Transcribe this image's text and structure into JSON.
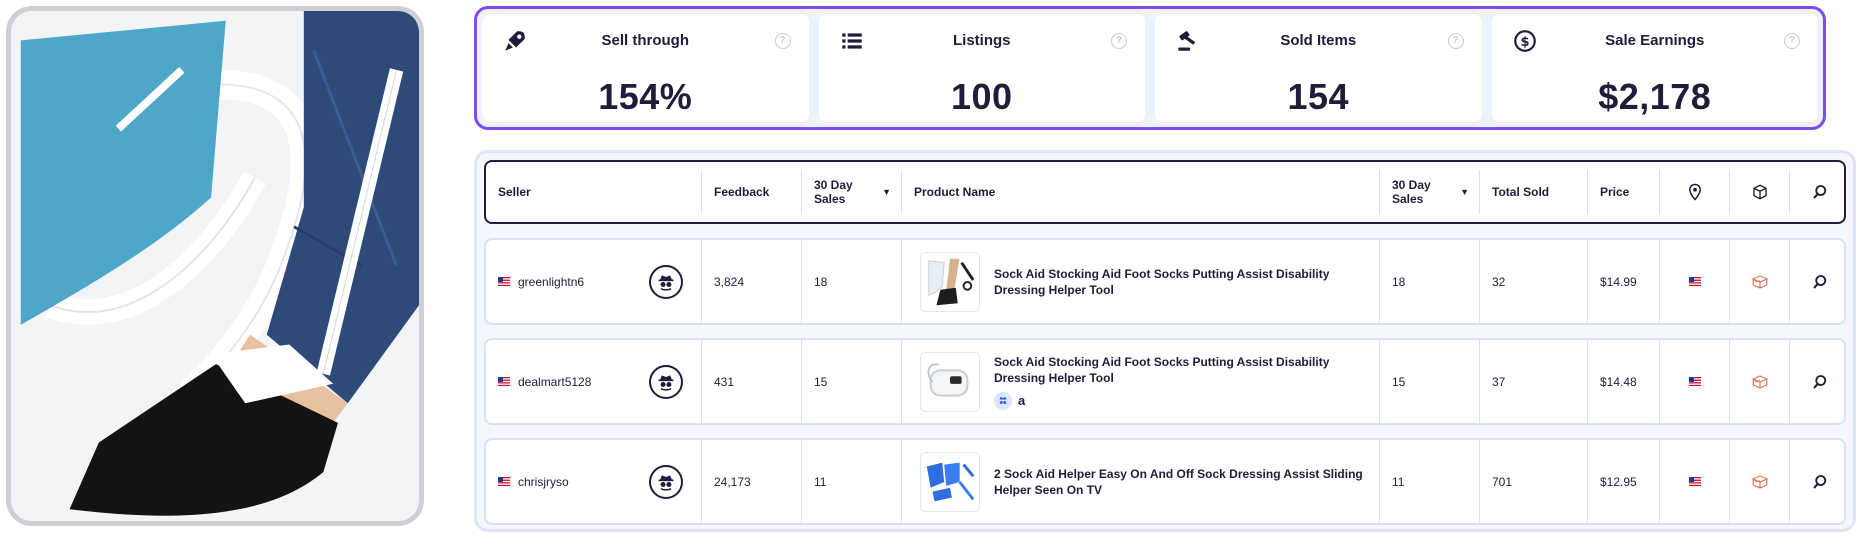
{
  "stats": [
    {
      "label": "Sell through",
      "value": "154%",
      "icon": "rocket-icon",
      "help": "?"
    },
    {
      "label": "Listings",
      "value": "100",
      "icon": "list-icon",
      "help": "?"
    },
    {
      "label": "Sold Items",
      "value": "154",
      "icon": "gavel-icon",
      "help": "?"
    },
    {
      "label": "Sale Earnings",
      "value": "$2,178",
      "icon": "dollar-coin-icon",
      "help": "?"
    }
  ],
  "table": {
    "headers": {
      "seller": "Seller",
      "feedback": "Feedback",
      "sales30_a": "30 Day Sales",
      "product": "Product Name",
      "sales30_b": "30 Day Sales",
      "total_sold": "Total Sold",
      "price": "Price",
      "sort_mark": "▼"
    },
    "rows": [
      {
        "seller": "greenlightn6",
        "feedback": "3,824",
        "sales30": "18",
        "product": "Sock Aid Stocking Aid Foot Socks Putting Assist Disability Dressing Helper Tool",
        "sales30b": "18",
        "total_sold": "32",
        "price": "$14.99",
        "badges": []
      },
      {
        "seller": "dealmart5128",
        "feedback": "431",
        "sales30": "15",
        "product": "Sock Aid Stocking Aid Foot Socks Putting Assist Disability Dressing Helper Tool",
        "sales30b": "15",
        "total_sold": "37",
        "price": "$14.48",
        "badges": [
          "a"
        ]
      },
      {
        "seller": "chrisjryso",
        "feedback": "24,173",
        "sales30": "11",
        "product": "2 Sock Aid Helper Easy On And Off Sock Dressing Assist Sliding Helper Seen On TV",
        "sales30b": "11",
        "total_sold": "701",
        "price": "$12.95",
        "badges": []
      }
    ]
  },
  "colors": {
    "accent": "#7c4dea",
    "ink": "#1f1d3a",
    "panel": "#f4f7fd",
    "shipping_icon": "#e0765a"
  }
}
